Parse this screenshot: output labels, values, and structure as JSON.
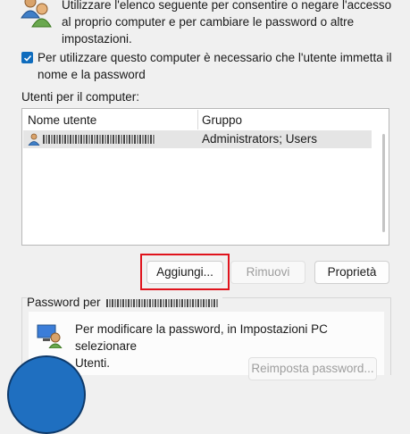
{
  "intro": {
    "lines": [
      "Utilizzare l'elenco seguente per consentire o negare l'accesso",
      "al proprio computer e per cambiare le password o altre",
      "impostazioni."
    ]
  },
  "require_login": {
    "checked": true,
    "lines": [
      "Per utilizzare questo computer è necessario che l'utente immetta il",
      "nome e la password"
    ]
  },
  "users_label": "Utenti per il computer:",
  "table": {
    "headers": [
      "Nome utente",
      "Gruppo"
    ],
    "rows": [
      {
        "group": "Administrators; Users",
        "selected": true
      }
    ]
  },
  "buttons": {
    "add": "Aggiungi...",
    "remove": "Rimuovi",
    "properties": "Proprietà"
  },
  "password_group": {
    "title_prefix": "Password per",
    "lines": [
      "Per modificare la password, in Impostazioni PC selezionare",
      "Utenti."
    ],
    "reset_button": "Reimposta password..."
  },
  "colors": {
    "accent": "#0f6cbd",
    "highlight": "#e0131c"
  }
}
